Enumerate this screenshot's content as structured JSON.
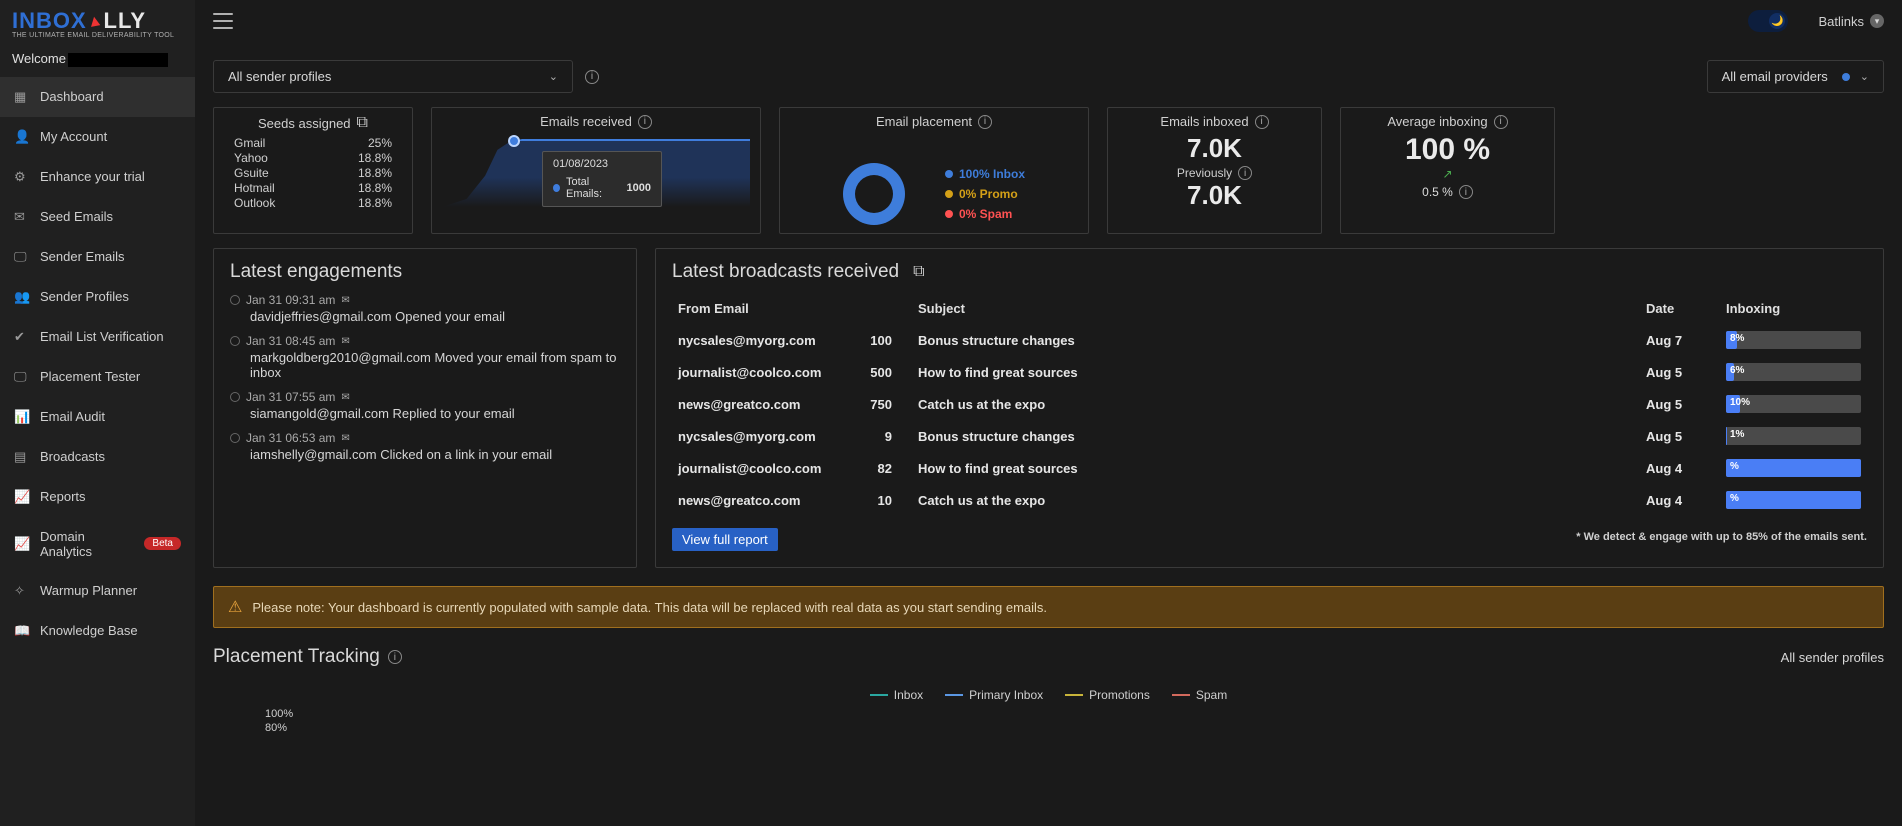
{
  "brand": {
    "line1_prefix": "INBOX",
    "line1_suffix": "LLY",
    "line2": "THE ULTIMATE EMAIL DELIVERABILITY TOOL"
  },
  "welcome": {
    "prefix": "Welcome"
  },
  "nav": {
    "items": [
      {
        "label": "Dashboard",
        "name": "dashboard",
        "active": true
      },
      {
        "label": "My Account",
        "name": "my-account"
      },
      {
        "label": "Enhance your trial",
        "name": "enhance-trial"
      },
      {
        "label": "Seed Emails",
        "name": "seed-emails"
      },
      {
        "label": "Sender Emails",
        "name": "sender-emails"
      },
      {
        "label": "Sender Profiles",
        "name": "sender-profiles"
      },
      {
        "label": "Email List Verification",
        "name": "email-list-verification"
      },
      {
        "label": "Placement Tester",
        "name": "placement-tester"
      },
      {
        "label": "Email Audit",
        "name": "email-audit"
      },
      {
        "label": "Broadcasts",
        "name": "broadcasts"
      },
      {
        "label": "Reports",
        "name": "reports"
      },
      {
        "label": "Domain Analytics",
        "name": "domain-analytics",
        "badge": "Beta"
      },
      {
        "label": "Warmup Planner",
        "name": "warmup-planner"
      },
      {
        "label": "Knowledge Base",
        "name": "knowledge-base"
      }
    ]
  },
  "topbar": {
    "user": "Batlinks"
  },
  "filters": {
    "profiles": "All sender profiles",
    "providers": "All email providers"
  },
  "cards": {
    "seeds": {
      "title": "Seeds assigned",
      "rows": [
        {
          "name": "Gmail",
          "pct": "25%"
        },
        {
          "name": "Yahoo",
          "pct": "18.8%"
        },
        {
          "name": "Gsuite",
          "pct": "18.8%"
        },
        {
          "name": "Hotmail",
          "pct": "18.8%"
        },
        {
          "name": "Outlook",
          "pct": "18.8%"
        }
      ]
    },
    "emails": {
      "title": "Emails received",
      "tooltip": {
        "date": "01/08/2023",
        "label": "Total Emails:",
        "value": "1000"
      }
    },
    "placement": {
      "title": "Email placement",
      "rows": [
        {
          "color": "#3e7ddb",
          "text": "100% Inbox"
        },
        {
          "color": "#d4a017",
          "text": "0% Promo"
        },
        {
          "color": "#ff5252",
          "text": "0% Spam"
        }
      ]
    },
    "inboxed": {
      "title": "Emails inboxed",
      "value": "7.0K",
      "prev_label": "Previously",
      "prev_value": "7.0K"
    },
    "avg": {
      "title": "Average inboxing",
      "value": "100 %",
      "trend": "↗",
      "delta": "0.5 %"
    }
  },
  "engagements": {
    "title": "Latest engagements",
    "items": [
      {
        "time": "Jan 31 09:31 am",
        "body": "davidjeffries@gmail.com Opened your email"
      },
      {
        "time": "Jan 31 08:45 am",
        "body": "markgoldberg2010@gmail.com Moved your email from spam to inbox"
      },
      {
        "time": "Jan 31 07:55 am",
        "body": "siamangold@gmail.com Replied to your email"
      },
      {
        "time": "Jan 31 06:53 am",
        "body": "iamshelly@gmail.com Clicked on a link in your email"
      }
    ]
  },
  "broadcasts": {
    "title": "Latest broadcasts received",
    "columns": {
      "from": "From Email",
      "subject": "Subject",
      "date": "Date",
      "inboxing": "Inboxing"
    },
    "rows": [
      {
        "from": "nycsales@myorg.com",
        "count": "100",
        "subject": "Bonus structure changes",
        "date": "Aug 7",
        "pct": "8%",
        "w": 8
      },
      {
        "from": "journalist@coolco.com",
        "count": "500",
        "subject": "How to find great sources",
        "date": "Aug 5",
        "pct": "6%",
        "w": 6
      },
      {
        "from": "news@greatco.com",
        "count": "750",
        "subject": "Catch us at the expo",
        "date": "Aug 5",
        "pct": "10%",
        "w": 10
      },
      {
        "from": "nycsales@myorg.com",
        "count": "9",
        "subject": "Bonus structure changes",
        "date": "Aug 5",
        "pct": "1%",
        "w": 1
      },
      {
        "from": "journalist@coolco.com",
        "count": "82",
        "subject": "How to find great sources",
        "date": "Aug 4",
        "pct": "%",
        "w": 100
      },
      {
        "from": "news@greatco.com",
        "count": "10",
        "subject": "Catch us at the expo",
        "date": "Aug 4",
        "pct": "%",
        "w": 100
      }
    ],
    "view_full": "View full report",
    "footnote": "* We detect & engage with up to 85% of the emails sent."
  },
  "warn": {
    "text": "Please note: Your dashboard is currently populated with sample data. This data will be replaced with real data as you start sending emails."
  },
  "placetrack": {
    "title": "Placement Tracking",
    "right": "All sender profiles",
    "legend": [
      {
        "color": "#2aa7a0",
        "label": "Inbox"
      },
      {
        "color": "#5b97e3",
        "label": "Primary Inbox"
      },
      {
        "color": "#c8b43a",
        "label": "Promotions"
      },
      {
        "color": "#d36a5d",
        "label": "Spam"
      }
    ],
    "axis": [
      "100%",
      "80%"
    ]
  },
  "chart_data": {
    "emails_received": {
      "type": "area",
      "title": "Emails received",
      "tooltip_date": "01/08/2023",
      "tooltip_series": "Total Emails",
      "tooltip_value": 1000,
      "ylim": [
        0,
        1000
      ]
    },
    "email_placement": {
      "type": "pie",
      "title": "Email placement",
      "series": [
        {
          "name": "Inbox",
          "value": 100,
          "color": "#3e7ddb"
        },
        {
          "name": "Promo",
          "value": 0,
          "color": "#d4a017"
        },
        {
          "name": "Spam",
          "value": 0,
          "color": "#ff5252"
        }
      ]
    },
    "placement_tracking": {
      "type": "line",
      "title": "Placement Tracking",
      "ylabel": "%",
      "ylim": [
        0,
        100
      ],
      "series": [
        {
          "name": "Inbox",
          "color": "#2aa7a0"
        },
        {
          "name": "Primary Inbox",
          "color": "#5b97e3"
        },
        {
          "name": "Promotions",
          "color": "#c8b43a"
        },
        {
          "name": "Spam",
          "color": "#d36a5d"
        }
      ]
    }
  }
}
